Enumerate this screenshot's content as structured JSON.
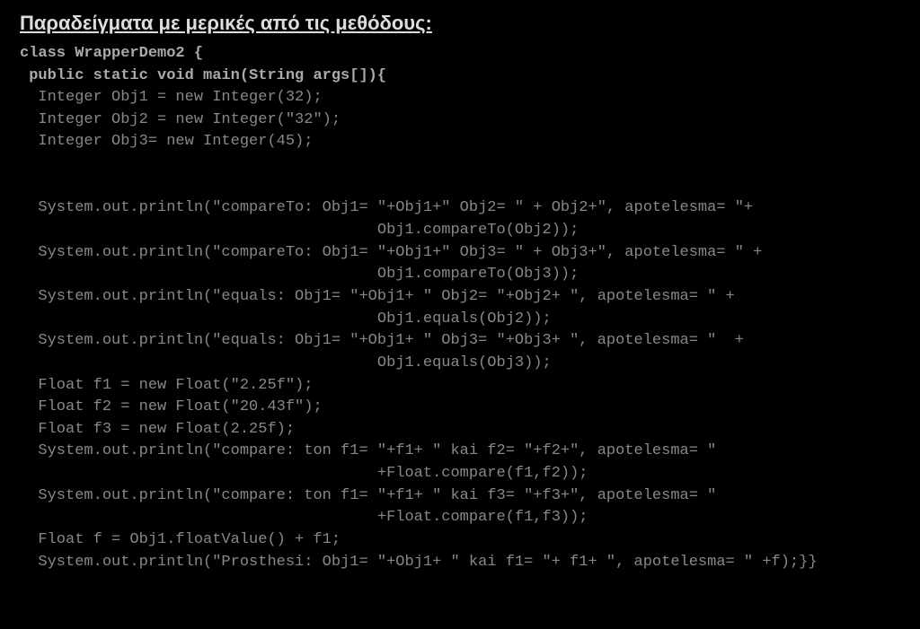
{
  "heading": "Παραδείγματα με μερικές από τις μεθόδους:",
  "code": {
    "l01": "class WrapperDemo2 {",
    "l02": " public static void main(String args[]){",
    "l03": "  Integer Obj1 = new Integer(32);",
    "l04": "  Integer Obj2 = new Integer(\"32\");",
    "l05": "  Integer Obj3= new Integer(45);",
    "l06": "",
    "l07": "",
    "l08": "  System.out.println(\"compareTo: Obj1= \"+Obj1+\" Obj2= \" + Obj2+\", apotelesma= \"+",
    "l09": "                                       Obj1.compareTo(Obj2));",
    "l10": "  System.out.println(\"compareTo: Obj1= \"+Obj1+\" Obj3= \" + Obj3+\", apotelesma= \" +",
    "l11": "                                       Obj1.compareTo(Obj3));",
    "l12": "  System.out.println(\"equals: Obj1= \"+Obj1+ \" Obj2= \"+Obj2+ \", apotelesma= \" +",
    "l13": "                                       Obj1.equals(Obj2));",
    "l14": "  System.out.println(\"equals: Obj1= \"+Obj1+ \" Obj3= \"+Obj3+ \", apotelesma= \"  +",
    "l15": "                                       Obj1.equals(Obj3));",
    "l16": "  Float f1 = new Float(\"2.25f\");",
    "l17": "  Float f2 = new Float(\"20.43f\");",
    "l18": "  Float f3 = new Float(2.25f);",
    "l19": "  System.out.println(\"compare: ton f1= \"+f1+ \" kai f2= \"+f2+\", apotelesma= \"",
    "l20": "                                       +Float.compare(f1,f2));",
    "l21": "  System.out.println(\"compare: ton f1= \"+f1+ \" kai f3= \"+f3+\", apotelesma= \"",
    "l22": "                                       +Float.compare(f1,f3));",
    "l23": "  Float f = Obj1.floatValue() + f1;",
    "l24": "  System.out.println(\"Prosthesi: Obj1= \"+Obj1+ \" kai f1= \"+ f1+ \", apotelesma= \" +f);}}"
  }
}
